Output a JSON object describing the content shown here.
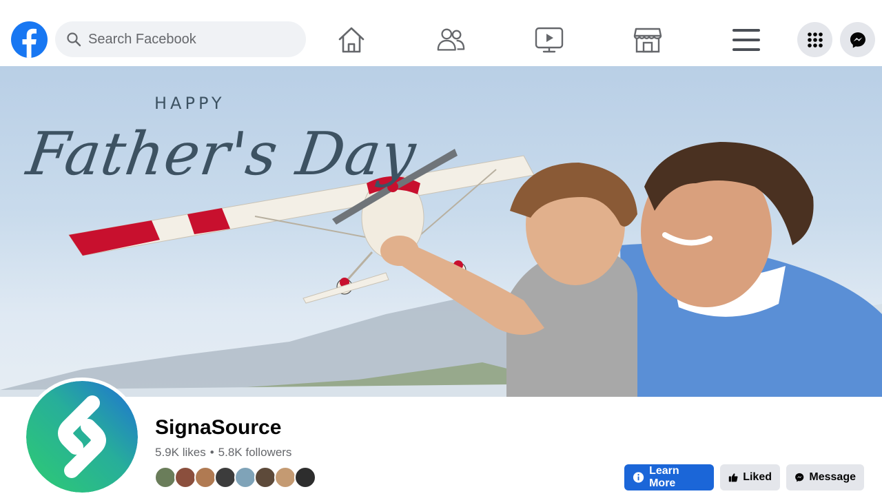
{
  "header": {
    "search": {
      "placeholder": "Search Facebook"
    },
    "nav_icons": [
      "home-icon",
      "friends-icon",
      "watch-icon",
      "marketplace-icon",
      "menu-icon"
    ],
    "right_icons": [
      "apps-grid-icon",
      "messenger-icon"
    ]
  },
  "cover": {
    "line1": "HAPPY",
    "line2": "Father's Day"
  },
  "page": {
    "name": "SignaSource",
    "likes": "5.9K likes",
    "separator": "•",
    "followers": "5.8K followers",
    "friend_count": 8
  },
  "actions": {
    "learn_more": "Learn More",
    "liked": "Liked",
    "message": "Message"
  },
  "colors": {
    "brand": "#1877f2",
    "primary_button": "#1b66d8",
    "secondary_button": "#e4e6eb",
    "muted_text": "#65676b",
    "cover_text": "#3d5262"
  }
}
